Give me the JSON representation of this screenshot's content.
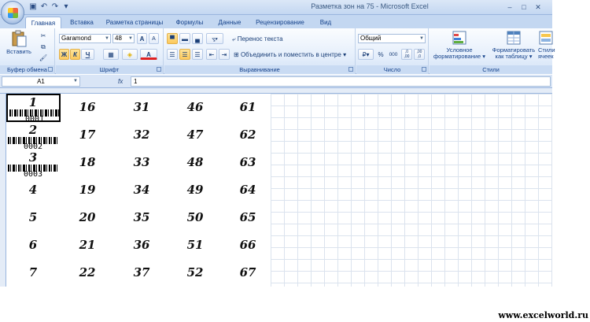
{
  "window": {
    "title": "Разметка зон на 75 - Microsoft Excel",
    "qat": {
      "save_icon": "save-icon",
      "undo_icon": "undo-icon",
      "redo_icon": "redo-icon",
      "dropdown_icon": "chevron-down-icon"
    },
    "controls": {
      "minimize": "–",
      "maximize": "□",
      "close": "✕"
    }
  },
  "tabs": [
    {
      "label": "Главная",
      "active": true
    },
    {
      "label": "Вставка"
    },
    {
      "label": "Разметка страницы"
    },
    {
      "label": "Формулы"
    },
    {
      "label": "Данные"
    },
    {
      "label": "Рецензирование"
    },
    {
      "label": "Вид"
    }
  ],
  "ribbon": {
    "clipboard": {
      "label": "Буфер обмена",
      "paste_label": "Вставить"
    },
    "font": {
      "label": "Шрифт",
      "font_name": "Garamond",
      "font_size": "48",
      "bold": "Ж",
      "italic": "К",
      "underline": "Ч",
      "grow": "A",
      "shrink": "A",
      "color_letter": "A",
      "accent_color": "#e02020"
    },
    "alignment": {
      "label": "Выравнивание",
      "wrap_text": "Перенос текста",
      "merge_center": "Объединить и поместить в центре"
    },
    "number": {
      "label": "Число",
      "format": "Общий",
      "percent": "%",
      "thousands": "000",
      "inc_dec": ",0 ,00",
      "dec_dec": ",00 ,0"
    },
    "styles": {
      "label": "Стили",
      "conditional_line1": "Условное",
      "conditional_line2": "форматирование",
      "table_line1": "Форматировать",
      "table_line2": "как таблицу",
      "cell_line1": "Стили",
      "cell_line2": "ячеек"
    }
  },
  "formula_bar": {
    "name_box": "A1",
    "fx": "fx",
    "value": "1"
  },
  "sheet": {
    "columns": [
      [
        "1",
        "2",
        "3",
        "4",
        "5",
        "6",
        "7"
      ],
      [
        "16",
        "17",
        "18",
        "19",
        "20",
        "21",
        "22"
      ],
      [
        "31",
        "32",
        "33",
        "34",
        "35",
        "36",
        "37"
      ],
      [
        "46",
        "47",
        "48",
        "49",
        "50",
        "51",
        "52"
      ],
      [
        "61",
        "62",
        "63",
        "64",
        "65",
        "66",
        "67"
      ]
    ],
    "barcodes": [
      "0001",
      "0002",
      "0003"
    ]
  },
  "watermark": "www.excelworld.ru"
}
